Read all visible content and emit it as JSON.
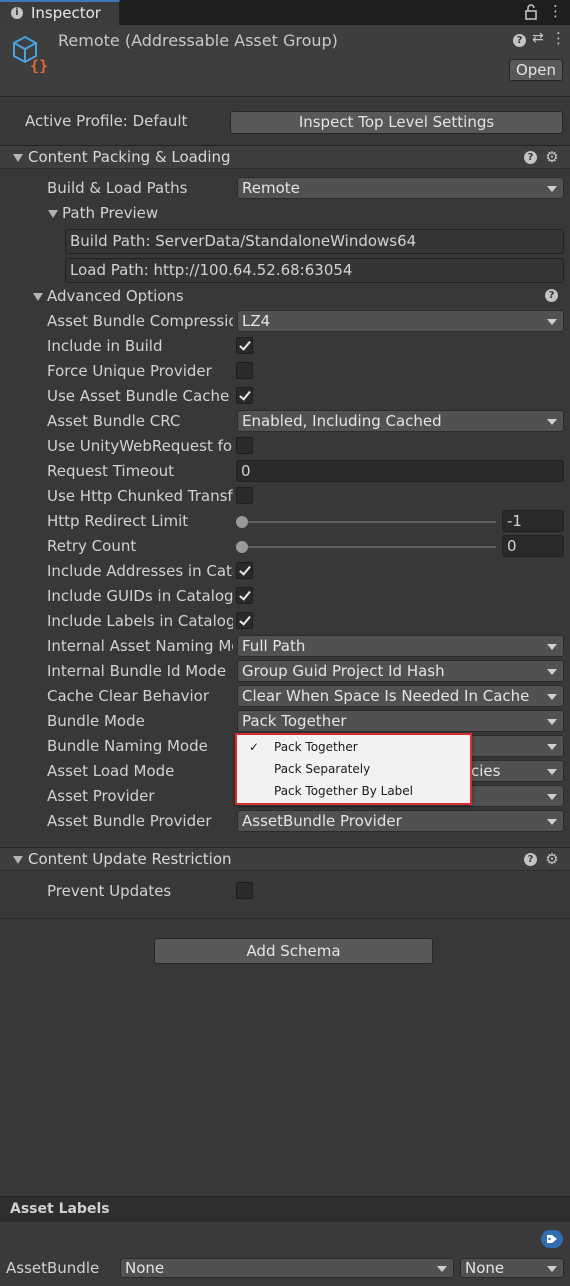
{
  "tab": {
    "label": "Inspector",
    "info_icon": "info-icon",
    "lock_icon": "lock-icon",
    "menu": "⋮"
  },
  "header": {
    "title": "Remote (Addressable Asset Group)",
    "open_label": "Open",
    "help_icon": "?",
    "settings_icon": "⇄",
    "menu_icon": "⋮"
  },
  "profile": {
    "label": "Active Profile: Default",
    "inspect_button": "Inspect Top Level Settings"
  },
  "content_packing": {
    "title": "Content Packing & Loading",
    "build_load_paths": {
      "label": "Build & Load Paths",
      "value": "Remote"
    },
    "path_preview": {
      "title": "Path Preview",
      "build_path": "Build Path: ServerData/StandaloneWindows64",
      "load_path": "Load Path: http://100.64.52.68:63054"
    },
    "advanced": {
      "title": "Advanced Options",
      "rows": [
        {
          "label": "Asset Bundle Compression",
          "type": "dropdown",
          "value": "LZ4"
        },
        {
          "label": "Include in Build",
          "type": "checkbox",
          "checked": true
        },
        {
          "label": "Force Unique Provider",
          "type": "checkbox",
          "checked": false
        },
        {
          "label": "Use Asset Bundle Cache",
          "type": "checkbox",
          "checked": true
        },
        {
          "label": "Asset Bundle CRC",
          "type": "dropdown",
          "value": "Enabled, Including Cached"
        },
        {
          "label": "Use UnityWebRequest for Local Asset Bundles",
          "type": "checkbox",
          "checked": false
        },
        {
          "label": "Request Timeout",
          "type": "text",
          "value": "0"
        },
        {
          "label": "Use Http Chunked Transfer",
          "type": "checkbox",
          "checked": false
        },
        {
          "label": "Http Redirect Limit",
          "type": "slider",
          "value": "-1"
        },
        {
          "label": "Retry Count",
          "type": "slider",
          "value": "0"
        },
        {
          "label": "Include Addresses in Catalog",
          "type": "checkbox",
          "checked": true
        },
        {
          "label": "Include GUIDs in Catalog",
          "type": "checkbox",
          "checked": true
        },
        {
          "label": "Include Labels in Catalog",
          "type": "checkbox",
          "checked": true
        },
        {
          "label": "Internal Asset Naming Mode",
          "type": "dropdown",
          "value": "Full Path"
        },
        {
          "label": "Internal Bundle Id Mode",
          "type": "dropdown",
          "value": "Group Guid Project Id Hash"
        },
        {
          "label": "Cache Clear Behavior",
          "type": "dropdown",
          "value": "Clear When Space Is Needed In Cache"
        },
        {
          "label": "Bundle Mode",
          "type": "dropdown",
          "value": "Pack Together"
        },
        {
          "label": "Bundle Naming Mode",
          "type": "dropdown",
          "value": ""
        },
        {
          "label": "Asset Load Mode",
          "type": "dropdown",
          "value": "cies"
        },
        {
          "label": "Asset Provider",
          "type": "dropdown",
          "value": ""
        },
        {
          "label": "Asset Bundle Provider",
          "type": "dropdown",
          "value": "AssetBundle Provider"
        }
      ]
    }
  },
  "bundle_mode_popup": {
    "options": [
      "Pack Together",
      "Pack Separately",
      "Pack Together By Label"
    ],
    "selected": "Pack Together",
    "check": "✓"
  },
  "content_update": {
    "title": "Content Update Restriction",
    "prevent_updates": {
      "label": "Prevent Updates",
      "checked": false
    }
  },
  "add_schema": "Add Schema",
  "asset_labels": {
    "title": "Asset Labels",
    "tag_icon": "tag-icon",
    "assetbundle_label": "AssetBundle",
    "name_value": "None",
    "variant_value": "None"
  },
  "colors": {
    "accent": "#3a79bb",
    "popup_border": "#d42b2b",
    "icon_blue": "#4aa3df",
    "icon_orange": "#e06c33"
  }
}
